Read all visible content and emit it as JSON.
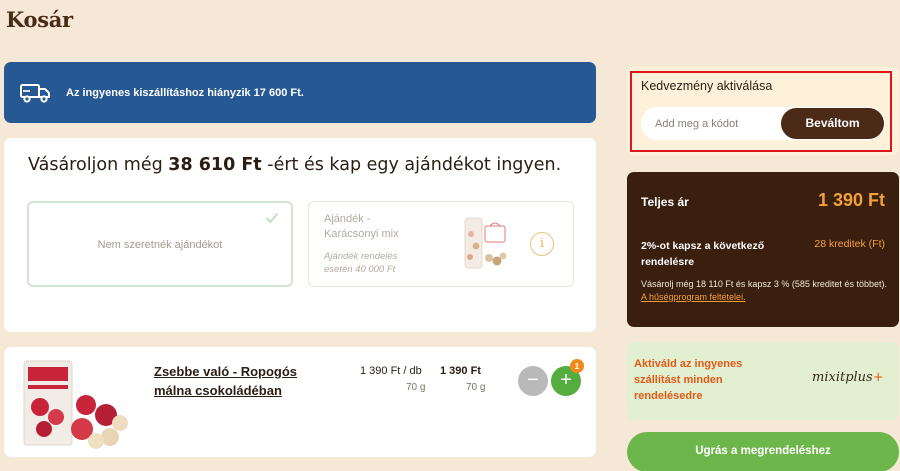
{
  "page": {
    "title": "Kosár"
  },
  "shipping_banner": {
    "text": "Az ingyenes kiszállításhoz hiányzik 17 600 Ft.",
    "icon": "truck-icon",
    "color": "#265993"
  },
  "gift": {
    "headline_prefix": "Vásároljon még",
    "headline_amount": "38 610 Ft",
    "headline_suffix": "-ért és kap egy ajándékot ingyen.",
    "option_none_label": "Nem szeretnék ajándékot",
    "option_mix_name": "Ajándék - Karácsonyi mix",
    "option_mix_condition": "Ajándék rendelés esetén 40 000 Ft",
    "info_glyph": "i"
  },
  "cart_item": {
    "name": "Zsebbe való - Ropogós málna csokoládéban",
    "unit_price": "1 390 Ft / db",
    "unit_weight": "70 g",
    "line_price": "1 390 Ft",
    "line_weight": "70 g",
    "minus_glyph": "−",
    "plus_glyph": "+",
    "quantity": "1"
  },
  "coupon": {
    "title": "Kedvezmény aktiválása",
    "placeholder": "Add meg a kódot",
    "button_label": "Beváltom"
  },
  "summary": {
    "total_label": "Teljes ár",
    "total_value": "1 390 Ft",
    "credit_label": "2%-ot kapsz a következő rendelésre",
    "credit_value": "28 kreditek (Ft)",
    "note_text": "Vásárolj még 18 110 Ft és kapsz 3 % (585 kreditet és többet). ",
    "note_link": "A hűségprogram feltételei."
  },
  "mixit": {
    "text": "Aktiváld az ingyenes szállítást minden rendelésedre",
    "logo_text": "mixit",
    "logo_suffix": "plus",
    "logo_plus": "+"
  },
  "checkout": {
    "label": "Ugrás a megrendeléshez"
  },
  "colors": {
    "accent_brown": "#4b2a17",
    "accent_orange": "#f2a13a",
    "green": "#6db64c",
    "highlight_red": "#e0141c"
  }
}
